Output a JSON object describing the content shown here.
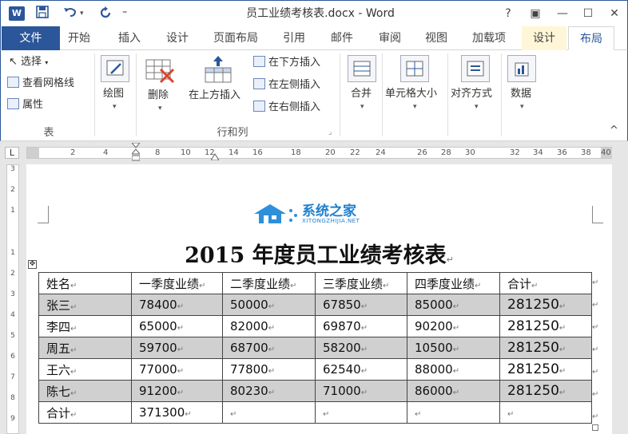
{
  "window": {
    "title": "员工业绩考核表.docx - Word",
    "app_logo": "W",
    "help": "?",
    "ribbon_display": "▣",
    "minimize": "—",
    "maximize": "☐",
    "close": "✕"
  },
  "quick_access": {
    "save_icon": "save-icon",
    "undo_icon": "undo-icon",
    "redo_icon": "redo-icon",
    "customize": "⁼"
  },
  "tabs": {
    "file": "文件",
    "items": [
      "开始",
      "插入",
      "设计",
      "页面布局",
      "引用",
      "邮件",
      "审阅",
      "视图",
      "加载项",
      "设计",
      "布局"
    ]
  },
  "ribbon": {
    "table_group": {
      "select": "选择",
      "view_gridlines": "查看网格线",
      "properties": "属性",
      "label": "表"
    },
    "draw": "绘图",
    "delete": "删除",
    "insert_above": "在上方插入",
    "insert_below": "在下方插入",
    "insert_left": "在左侧插入",
    "insert_right": "在右侧插入",
    "rows_cols_label": "行和列",
    "merge": "合并",
    "cell_size": "单元格大小",
    "alignment": "对齐方式",
    "data": "数据",
    "collapse": "^"
  },
  "ruler": {
    "corner": "L",
    "ticks": [
      "2",
      "4",
      "8",
      "10",
      "12",
      "14",
      "16",
      "18",
      "20",
      "22",
      "24",
      "26",
      "28",
      "30",
      "32",
      "34",
      "36",
      "38",
      "40"
    ],
    "vticks": [
      "3",
      "2",
      "1",
      "1",
      "2",
      "3",
      "4",
      "5",
      "6",
      "7",
      "8",
      "9"
    ]
  },
  "document": {
    "logo_text": "系统之家",
    "logo_sub": "XITONGZHIJIA.NET",
    "title": "2015 年度员工业绩考核表",
    "para_mark": "↵",
    "move_handle": "✥",
    "table": {
      "headers": [
        "姓名",
        "一季度业绩",
        "二季度业绩",
        "三季度业绩",
        "四季度业绩",
        "合计"
      ],
      "rows": [
        [
          "张三",
          "78400",
          "50000",
          "67850",
          "85000",
          "281250"
        ],
        [
          "李四",
          "65000",
          "82000",
          "69870",
          "90200",
          "281250"
        ],
        [
          "周五",
          "59700",
          "68700",
          "58200",
          "10500",
          "281250"
        ],
        [
          "王六",
          "77000",
          "77800",
          "62540",
          "88000",
          "281250"
        ],
        [
          "陈七",
          "91200",
          "80230",
          "71000",
          "86000",
          "281250"
        ],
        [
          "合计",
          "371300",
          "",
          "",
          "",
          ""
        ]
      ]
    }
  }
}
